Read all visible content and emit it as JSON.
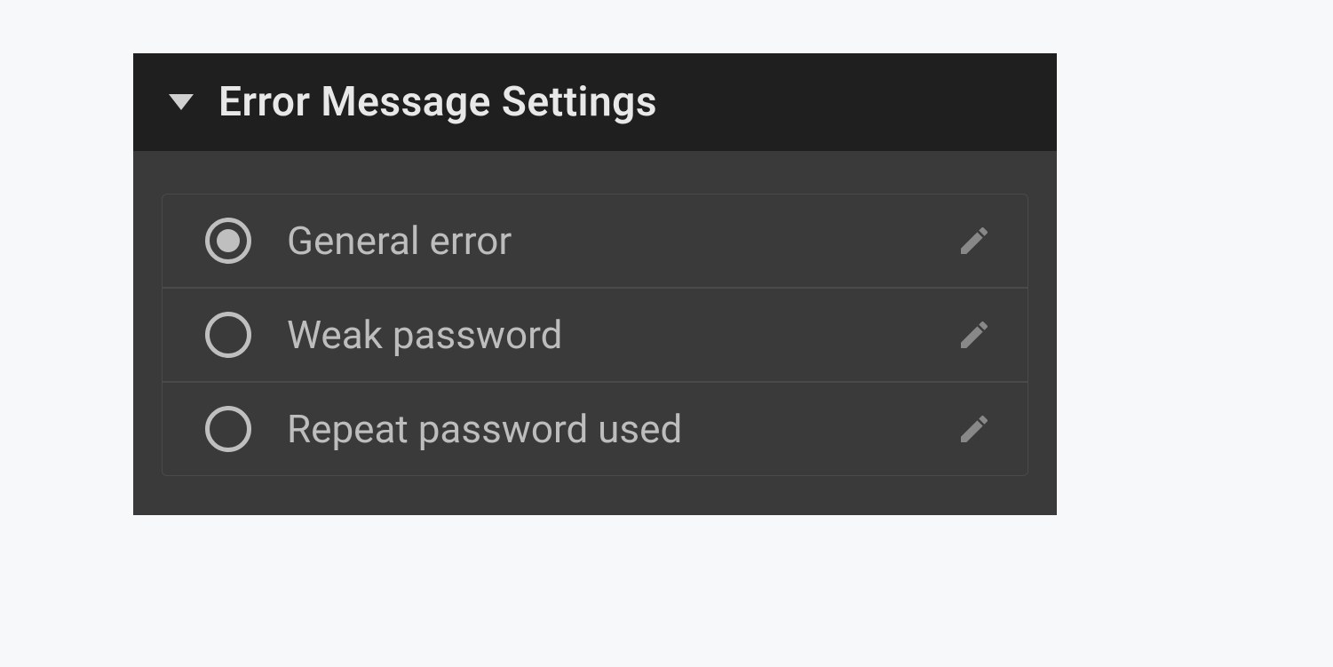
{
  "panel": {
    "title": "Error Message Settings",
    "options": [
      {
        "label": "General error",
        "selected": true
      },
      {
        "label": "Weak password",
        "selected": false
      },
      {
        "label": "Repeat password used",
        "selected": false
      }
    ]
  }
}
